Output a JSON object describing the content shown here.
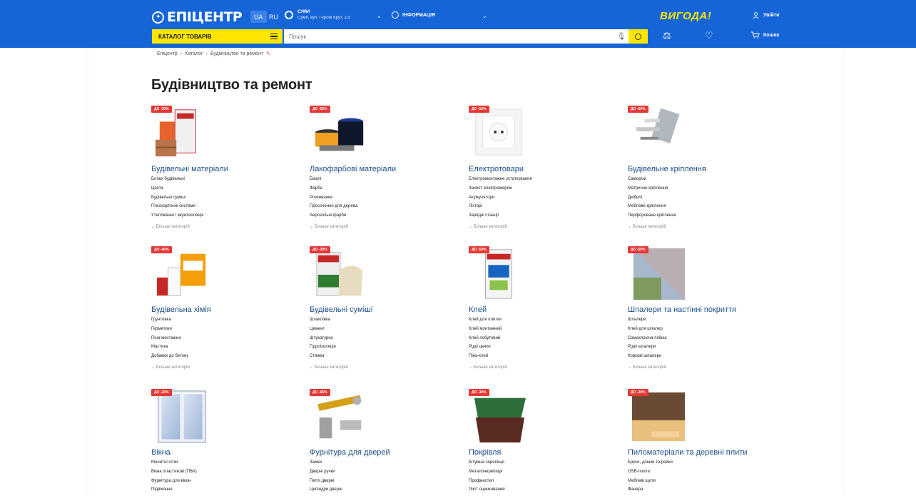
{
  "header": {
    "logo": "ЕПІЦЕНТР",
    "lang": [
      "UA",
      "RU"
    ],
    "city": {
      "name": "СУМИ",
      "address": "Суми, вул. Героїв Крут, 1/3"
    },
    "info": "ІНФОРМАЦІЯ",
    "vyhoda": "ВИГОДА!",
    "login": "Увійти",
    "catalog": "КАТАЛОГ ТОВАРІВ",
    "search_placeholder": "Пошук",
    "cart": "Кошик"
  },
  "breadcrumbs": [
    "Епіцентр",
    "Каталог",
    "Будівництво та ремонт"
  ],
  "title": "Будівництво та ремонт",
  "more_label": "Більше категорій",
  "categories": [
    {
      "title": "Будівельні матеріали",
      "badge": "ДО -30%",
      "items": [
        "Блоки будівельні",
        "Цегла",
        "Будівельні суміші",
        "Гіпсокартонні системи",
        "Утеплювачі і звукоізоляція"
      ]
    },
    {
      "title": "Лакофарбові матеріали",
      "badge": "ДО -55%",
      "items": [
        "Емалі",
        "Фарба",
        "Розчинники",
        "Просочення для дерева",
        "Аерозольні фарби"
      ]
    },
    {
      "title": "Електротовари",
      "badge": "ДО -15%",
      "items": [
        "Електромонтажне устаткування",
        "Захист електромереж",
        "Акумулятори",
        "Ліхтарі",
        "Зарядні станції"
      ]
    },
    {
      "title": "Будівельне кріплення",
      "badge": "ДО -60%",
      "items": [
        "Саморізи",
        "Метричне кріплення",
        "Дюбелі",
        "Меблеве кріплення",
        "Перфороване кріплення"
      ]
    },
    {
      "title": "Будівельна хімія",
      "badge": "ДО -40%",
      "items": [
        "Грунтовка",
        "Герметики",
        "Піна монтажна",
        "Мастика",
        "Добавки до бетону"
      ]
    },
    {
      "title": "Будівельні суміші",
      "badge": "ДО -30%",
      "items": [
        "Шпаклівка",
        "Цемент",
        "Штукатурка",
        "Гідроізоляція",
        "Стяжка"
      ]
    },
    {
      "title": "Клей",
      "badge": "ДО -50%",
      "items": [
        "Клей для плитки",
        "Клей монтажний",
        "Клей побутовий",
        "Рідкі цвяхи",
        "Піна-клей"
      ]
    },
    {
      "title": "Шпалери та настінні покриття",
      "badge": "ДО -50%",
      "items": [
        "Шпалери",
        "Клей для шпалер",
        "Самоклеюча плівка",
        "Рідкі шпалери",
        "Коркові шпалери"
      ]
    },
    {
      "title": "Вікна",
      "badge": "ДО -20%",
      "items": [
        "Москітні сітки",
        "Вікна пластикові (ПВХ)",
        "Фурнітура для вікон",
        "Підвіконня"
      ]
    },
    {
      "title": "Фурнітура для дверей",
      "badge": "ДО -65%",
      "items": [
        "Замки",
        "Дверні ручки",
        "Петлі дверні",
        "Циліндри дверні"
      ]
    },
    {
      "title": "Покрівля",
      "badge": "ДО -30%",
      "items": [
        "Бітумна черепиця",
        "Металочерепиця",
        "Профнастил",
        "Лист оцинкований"
      ]
    },
    {
      "title": "Пиломатеріали та деревні плити",
      "badge": "ДО -20%",
      "items": [
        "Бруси, дошки та рейки",
        "OSB-плити",
        "Меблеві щити",
        "Фанера"
      ]
    }
  ]
}
